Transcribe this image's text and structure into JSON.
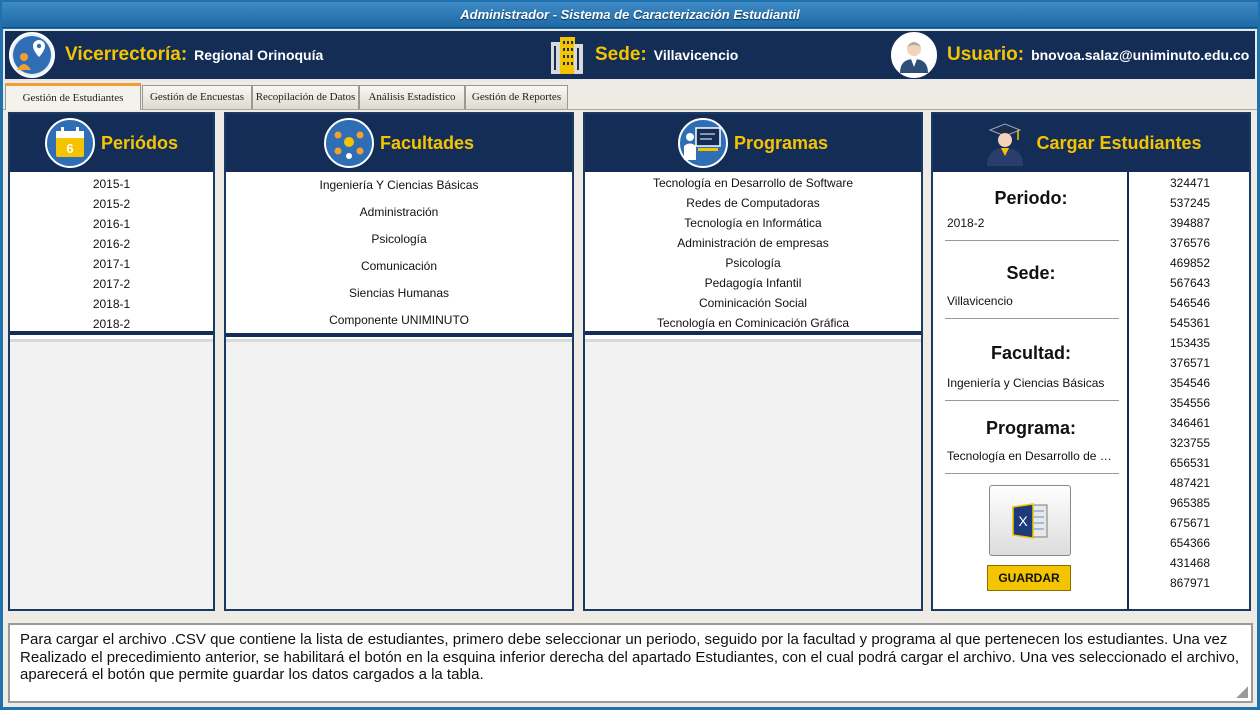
{
  "window": {
    "title": "Administrador - Sistema de Caracterización Estudiantil"
  },
  "header": {
    "vicerrectoria_label": "Vicerrectoría:",
    "vicerrectoria_value": "Regional Orinoquía",
    "sede_label": "Sede:",
    "sede_value": "Villavicencio",
    "usuario_label": "Usuario:",
    "usuario_value": "bnovoa.salaz@uniminuto.edu.co"
  },
  "tabs": [
    {
      "label": "Gestión de Estudiantes",
      "active": true
    },
    {
      "label": "Gestión de Encuestas",
      "active": false
    },
    {
      "label": "Recopilación de Datos",
      "active": false
    },
    {
      "label": "Análisis Estadístico",
      "active": false
    },
    {
      "label": "Gestión de Reportes",
      "active": false
    }
  ],
  "periodos": {
    "title": "Periódos",
    "calendar_number": "6",
    "items": [
      "2015-1",
      "2015-2",
      "2016-1",
      "2016-2",
      "2017-1",
      "2017-2",
      "2018-1",
      "2018-2"
    ]
  },
  "facultades": {
    "title": "Facultades",
    "items": [
      "Ingeniería Y Ciencias Básicas",
      "Administración",
      "Psicología",
      "Comunicación",
      "Siencias Humanas",
      "Componente UNIMINUTO"
    ]
  },
  "programas": {
    "title": "Programas",
    "items": [
      "Tecnología en Desarrollo de Software",
      "Redes de Computadoras",
      "Tecnología en Informática",
      "Administración de empresas",
      "Psicología",
      "Pedagogía Infantil",
      "Cominicación Social",
      "Tecnología en Cominicación Gráfica"
    ]
  },
  "cargar": {
    "title": "Cargar Estudiantes",
    "periodo_label": "Periodo:",
    "periodo_value": "2018-2",
    "sede_label": "Sede:",
    "sede_value": "Villavicencio",
    "facultad_label": "Facultad:",
    "facultad_value": "Ingeniería y Ciencias Básicas",
    "programa_label": "Programa:",
    "programa_value": "Tecnología en Desarrollo de Software",
    "excel_letter": "X",
    "save_label": "GUARDAR",
    "student_ids": [
      "324471",
      "537245",
      "394887",
      "376576",
      "469852",
      "567643",
      "546546",
      "545361",
      "153435",
      "376571",
      "354546",
      "354556",
      "346461",
      "323755",
      "656531",
      "487421",
      "965385",
      "675671",
      "654366",
      "431468",
      "867971"
    ]
  },
  "info_text": "Para cargar el archivo .CSV que contiene la lista de estudiantes, primero debe seleccionar un periodo, seguido por la facultad y programa al que pertenecen los estudiantes. Una vez Realizado el precedimiento anterior, se habilitará el botón en la esquina inferior derecha del apartado Estudiantes, con el cual podrá cargar el archivo. Una ves seleccionado el archivo, aparecerá el botón que permite guardar los datos cargados a la tabla.",
  "colors": {
    "navy": "#132d57",
    "gold": "#f5c400",
    "window_blue": "#1e72b0"
  },
  "icons": [
    "location-person-icon",
    "building-icon",
    "user-avatar-icon",
    "calendar-icon",
    "faculty-people-icon",
    "teacher-board-icon",
    "graduate-icon",
    "excel-icon"
  ]
}
